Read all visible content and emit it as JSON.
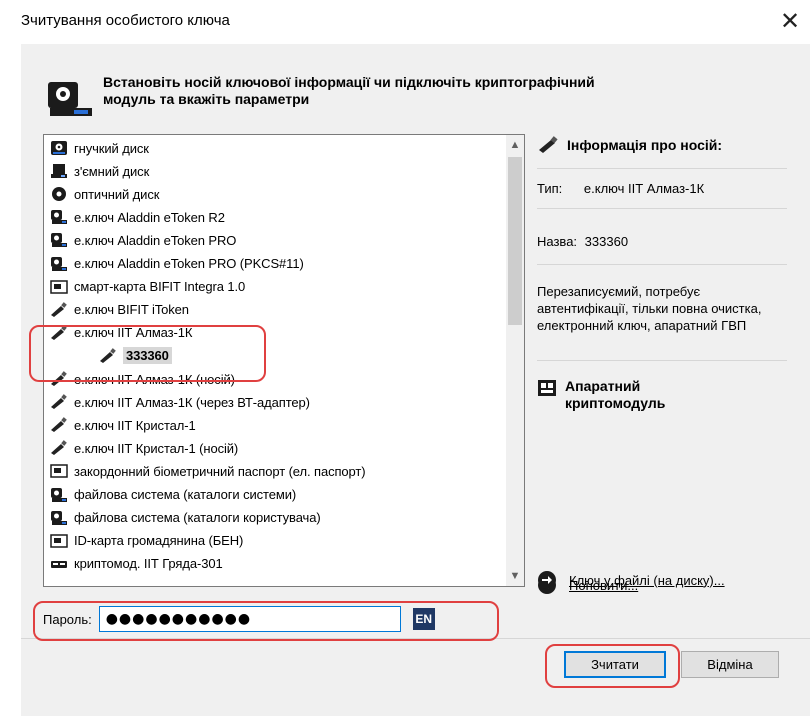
{
  "window": {
    "title": "Зчитування особистого ключа",
    "close_glyph": "✕"
  },
  "header": {
    "line1": "Встановіть носій ключової інформації чи підключіть криптографічний",
    "line2": "модуль та вкажіть параметри"
  },
  "devices": [
    {
      "label": "гнучкий диск",
      "icon": "floppy-disk-icon"
    },
    {
      "label": "з'ємний диск",
      "icon": "removable-disk-icon"
    },
    {
      "label": "оптичний диск",
      "icon": "optical-disc-icon"
    },
    {
      "label": "е.ключ Aladdin eToken R2",
      "icon": "token-icon"
    },
    {
      "label": "е.ключ Aladdin eToken PRO",
      "icon": "token-icon"
    },
    {
      "label": "е.ключ Aladdin eToken PRO (PKCS#11)",
      "icon": "token-icon"
    },
    {
      "label": "смарт-карта BIFIT Integra 1.0",
      "icon": "smart-card-icon"
    },
    {
      "label": "е.ключ BIFIT iToken",
      "icon": "usb-key-icon"
    },
    {
      "label": "е.ключ ІІТ Алмаз-1К",
      "icon": "usb-key-icon"
    },
    {
      "label": "333360",
      "icon": "usb-key-icon",
      "child": true,
      "selected": true
    },
    {
      "label": "е.ключ ІІТ Алмаз-1К (носій)",
      "icon": "usb-key-icon"
    },
    {
      "label": "е.ключ ІІТ Алмаз-1К (через ВТ-адаптер)",
      "icon": "usb-key-icon"
    },
    {
      "label": "е.ключ ІІТ Кристал-1",
      "icon": "usb-key-icon"
    },
    {
      "label": "е.ключ ІІТ Кристал-1 (носій)",
      "icon": "usb-key-icon"
    },
    {
      "label": "закордонний біометричний паспорт (ел. паспорт)",
      "icon": "smart-card-icon"
    },
    {
      "label": "файлова система (каталоги системи)",
      "icon": "token-icon"
    },
    {
      "label": "файлова система (каталоги користувача)",
      "icon": "token-icon"
    },
    {
      "label": "ID-карта громадянина (БЕН)",
      "icon": "smart-card-icon"
    },
    {
      "label": "криптомод. ІІТ Гряда-301",
      "icon": "crypto-module-icon"
    }
  ],
  "info": {
    "header": "Інформація про носій:",
    "type_label": "Тип:",
    "type_value": "е.ключ ІІТ Алмаз-1К",
    "name_label": "Назва:",
    "name_value": "333360",
    "description": "Перезаписуємий, потребує автентифікації, тільки повна очистка, електронний ключ, апаратний ГВП",
    "crypto_line1": "Апаратний",
    "crypto_line2": "криптомодуль",
    "refresh_link": "Поновити...",
    "file_key_link": "Ключ у файлі (на диску)..."
  },
  "password": {
    "label": "Пароль:",
    "value": "●●●●●●●●●●●",
    "lang": "EN"
  },
  "buttons": {
    "read": "Зчитати",
    "cancel": "Відміна"
  },
  "colors": {
    "highlight": "#e04040",
    "focus": "#0078d7",
    "lang_badge": "#1f3864"
  }
}
